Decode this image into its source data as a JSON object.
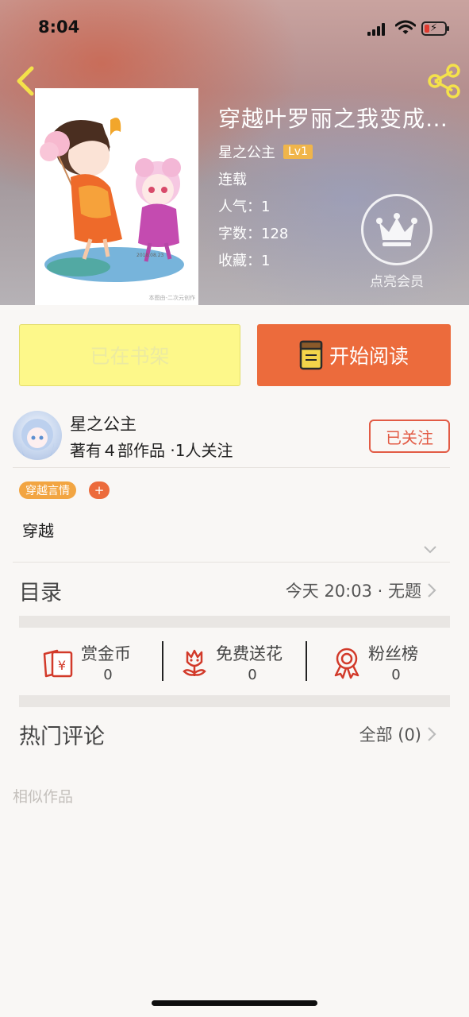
{
  "status_bar": {
    "time": "8:04"
  },
  "book": {
    "title": "穿越叶罗丽之我变成…",
    "author": "星之公主",
    "level": "Lv1",
    "status": "连载",
    "popularity": "人气：1",
    "word_count": "字数：128",
    "favorites": "收藏：1",
    "cover_caption": "本图由-二次元创作"
  },
  "vip": {
    "label": "点亮会员"
  },
  "actions": {
    "shelf_label": "已在书架",
    "read_label": "开始阅读"
  },
  "author_card": {
    "name": "星之公主",
    "meta": "著有４部作品 ·1人关注",
    "follow_label": "已关注"
  },
  "tags": {
    "genre": "穿越言情",
    "add": "+"
  },
  "description": "穿越",
  "toc": {
    "label": "目录",
    "latest": "今天 20:03 · 无题"
  },
  "stats": [
    {
      "label": "赏金币",
      "value": "0",
      "icon": "coin-envelope-icon"
    },
    {
      "label": "免费送花",
      "value": "0",
      "icon": "flower-icon"
    },
    {
      "label": "粉丝榜",
      "value": "0",
      "icon": "ribbon-medal-icon"
    }
  ],
  "comments": {
    "label": "热门评论",
    "all_link": "全部 (0)"
  },
  "similar": {
    "label": "相似作品"
  },
  "colors": {
    "accent": "#ec6b3c",
    "shelf_yellow": "#fdf88a",
    "follow_red": "#e25b45",
    "tag_orange": "#f2a542"
  }
}
